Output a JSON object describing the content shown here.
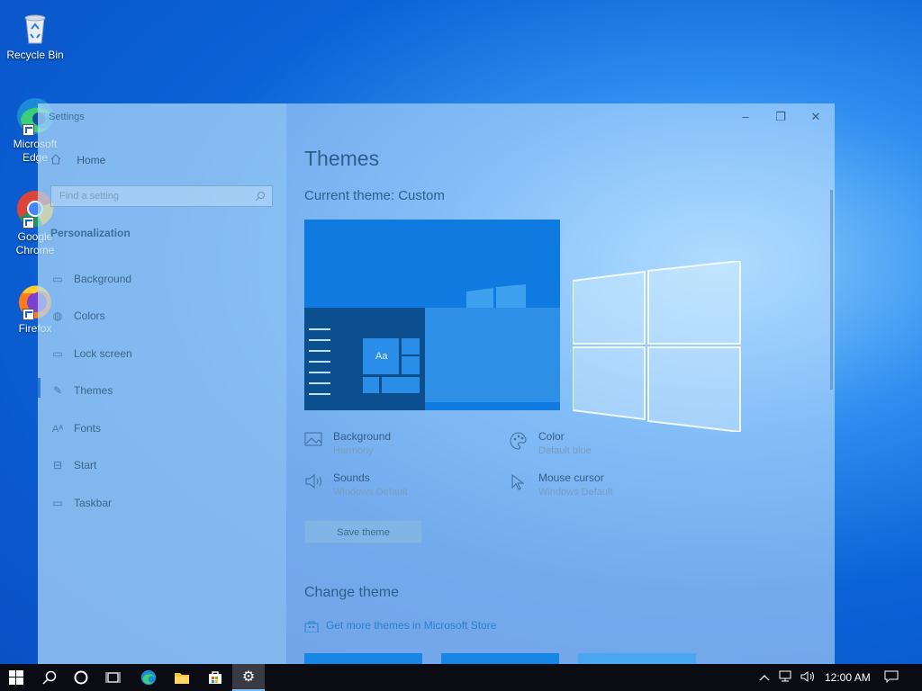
{
  "desktop": {
    "icons": [
      {
        "label": "Recycle Bin"
      },
      {
        "label": "Microsoft Edge"
      },
      {
        "label": "Google Chrome"
      },
      {
        "label": "Firefox"
      }
    ]
  },
  "window": {
    "title": "Settings",
    "controls": {
      "minimize": "–",
      "restore": "❐",
      "close": "✕"
    },
    "nav": {
      "home": "Home",
      "search_placeholder": "Find a setting",
      "section": "Personalization",
      "items": [
        {
          "label": "Background",
          "icon": "image-icon"
        },
        {
          "label": "Colors",
          "icon": "palette-icon"
        },
        {
          "label": "Lock screen",
          "icon": "lock-screen-icon"
        },
        {
          "label": "Themes",
          "icon": "themes-icon",
          "selected": true
        },
        {
          "label": "Fonts",
          "icon": "fonts-icon"
        },
        {
          "label": "Start",
          "icon": "start-icon"
        },
        {
          "label": "Taskbar",
          "icon": "taskbar-icon"
        }
      ]
    },
    "main": {
      "title": "Themes",
      "current_theme": "Current theme: Custom",
      "preview_tile_text": "Aa",
      "properties": [
        {
          "label": "Background",
          "value": "Harmony",
          "icon": "image-icon"
        },
        {
          "label": "Color",
          "value": "Default blue",
          "icon": "palette-icon"
        },
        {
          "label": "Sounds",
          "value": "Windows Default",
          "icon": "speaker-icon"
        },
        {
          "label": "Mouse cursor",
          "value": "Windows Default",
          "icon": "cursor-icon"
        }
      ],
      "save_button": "Save theme",
      "change_theme": "Change theme",
      "store_link": "Get more themes in Microsoft Store"
    }
  },
  "taskbar": {
    "clock": "12:00 AM"
  }
}
